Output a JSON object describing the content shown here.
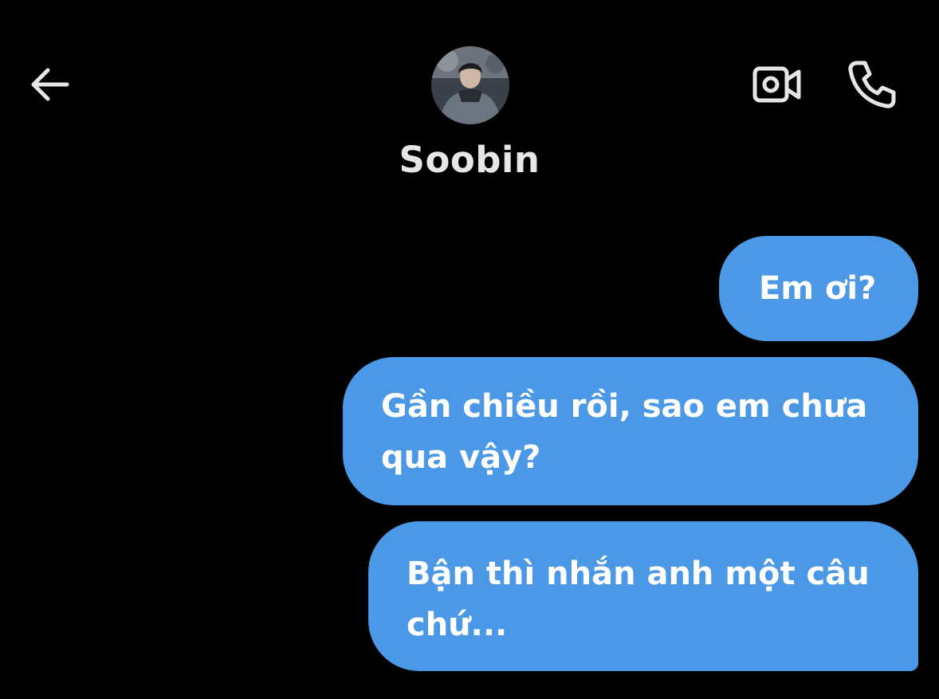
{
  "header": {
    "back_icon": "arrow-left-icon",
    "contact_name": "Soobin",
    "video_icon": "video-camera-icon",
    "call_icon": "phone-icon"
  },
  "messages": [
    {
      "sender": "self",
      "text": "Em ơi?"
    },
    {
      "sender": "self",
      "text": "Gần chiều rồi, sao em chưa qua vậy?"
    },
    {
      "sender": "self",
      "text": "Bận thì nhắn anh một câu chứ..."
    }
  ],
  "colors": {
    "background": "#000000",
    "bubble": "#4a98e6",
    "bubble_text": "#ffffff",
    "icon": "#e6e6e6"
  }
}
